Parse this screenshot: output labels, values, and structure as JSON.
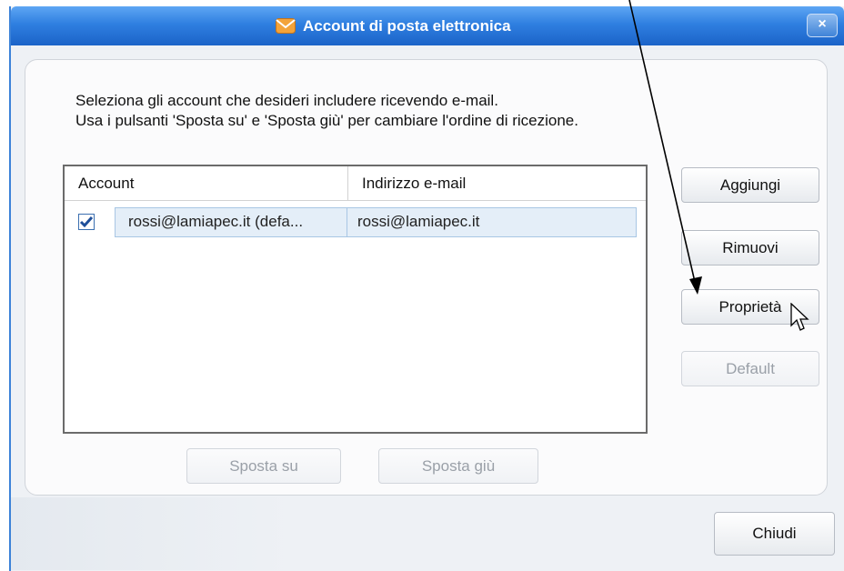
{
  "window": {
    "title": "Account di posta elettronica",
    "close_label": "×"
  },
  "instructions": {
    "line1": "Seleziona gli account che desideri includere ricevendo e-mail.",
    "line2": "Usa i pulsanti 'Sposta su' e 'Sposta giù' per cambiare l'ordine di ricezione."
  },
  "accounts_list": {
    "columns": [
      "Account",
      "Indirizzo e-mail"
    ],
    "rows": [
      {
        "checked": true,
        "account": "rossi@lamiapec.it (defa...",
        "email": "rossi@lamiapec.it"
      }
    ]
  },
  "buttons": {
    "add": "Aggiungi",
    "remove": "Rimuovi",
    "properties": "Proprietà",
    "default": "Default",
    "move_up": "Sposta su",
    "move_down": "Sposta giù",
    "close": "Chiudi"
  },
  "colors": {
    "titlebar": "#2f7fe0",
    "accent": "#3c82d8",
    "disabled_text": "#9aa0a8"
  },
  "icons": {
    "title": "mail-envelope-icon",
    "checkbox": "checkmark-icon",
    "cursor": "mouse-pointer-icon",
    "annotation": "annotation-arrow"
  }
}
